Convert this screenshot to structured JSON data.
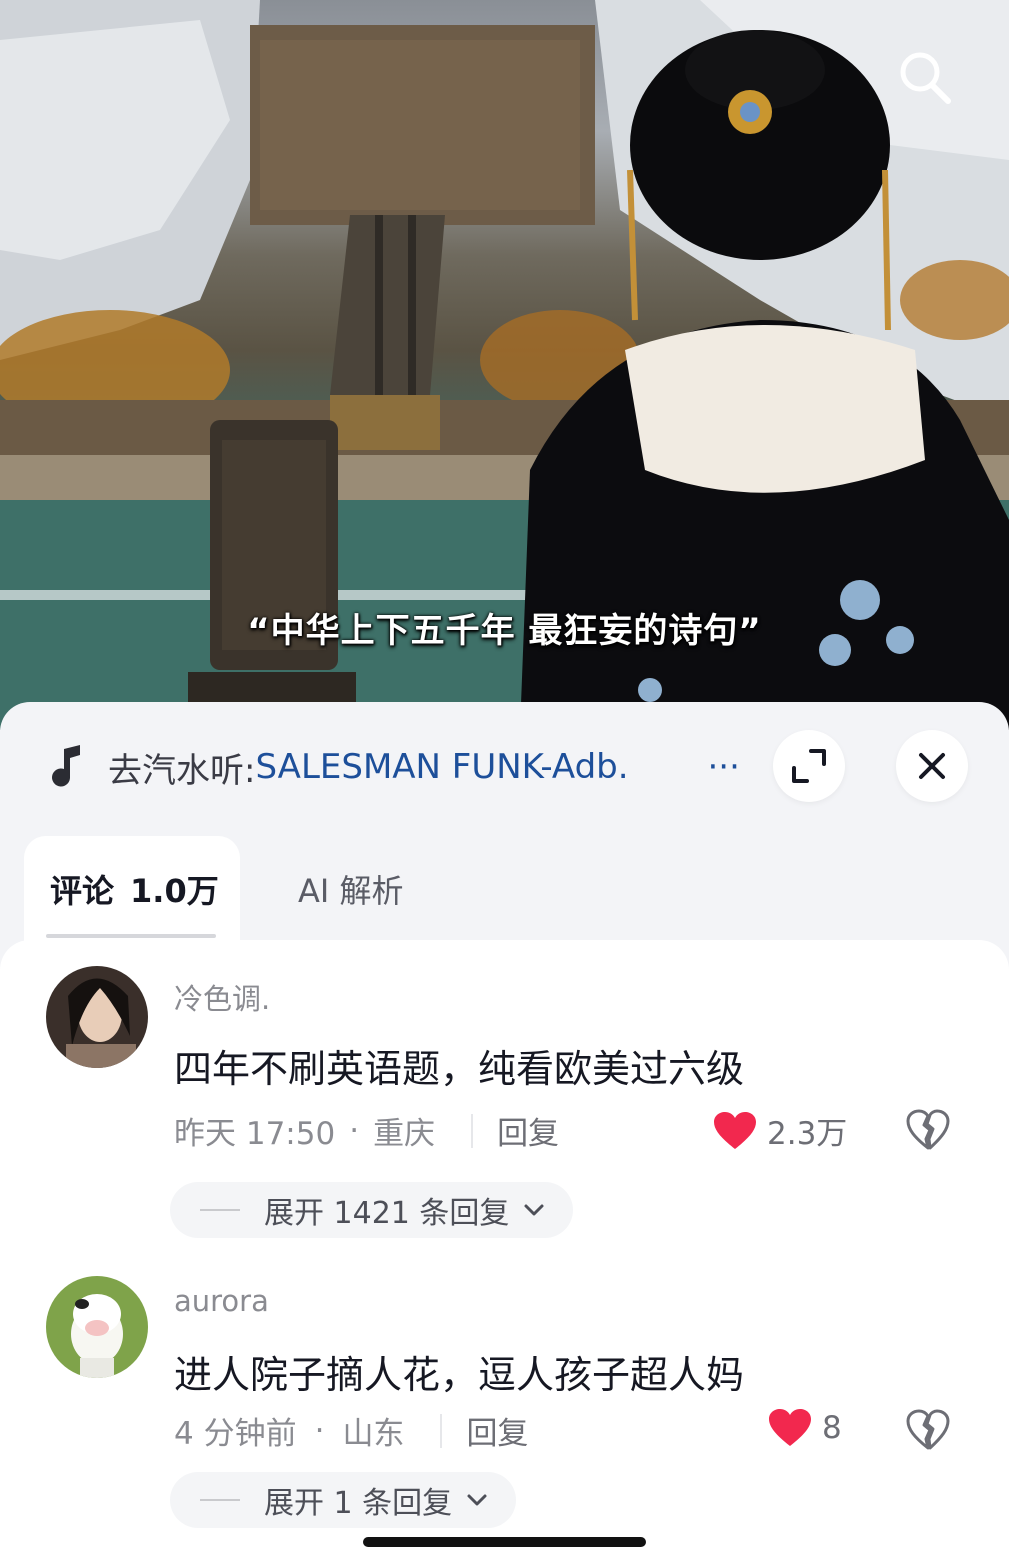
{
  "video": {
    "subtitle": "“中华上下五千年  最狂妄的诗句”",
    "search_icon": "search-icon"
  },
  "sheet": {
    "music": {
      "icon": "music-note-icon",
      "prefix": "去汽水听: ",
      "title": "SALESMAN FUNK-Adb.",
      "ellipsis": "···"
    },
    "expand_icon": "fullscreen-icon",
    "close_icon": "close-icon",
    "tabs": [
      {
        "label": "评论",
        "count": "1.0万",
        "active": true
      },
      {
        "label": "AI 解析",
        "active": false
      }
    ]
  },
  "comments": [
    {
      "username": "冷色调.",
      "text": "四年不刷英语题，纯看欧美过六级",
      "time": "昨天 17:50",
      "dot": "·",
      "location": "重庆",
      "reply_label": "回复",
      "likes": "2.3万",
      "expand_label": "展开 1421 条回复"
    },
    {
      "username": "aurora",
      "text": "进人院子摘人花，逗人孩子超人妈",
      "time": "4 分钟前",
      "dot": "·",
      "location": "山东",
      "reply_label": "回复",
      "likes": "8",
      "expand_label": "展开 1 条回复"
    }
  ],
  "colors": {
    "like_red": "#f2284e",
    "link_blue": "#1d4f9a",
    "sheet_bg": "#f3f4f7"
  }
}
